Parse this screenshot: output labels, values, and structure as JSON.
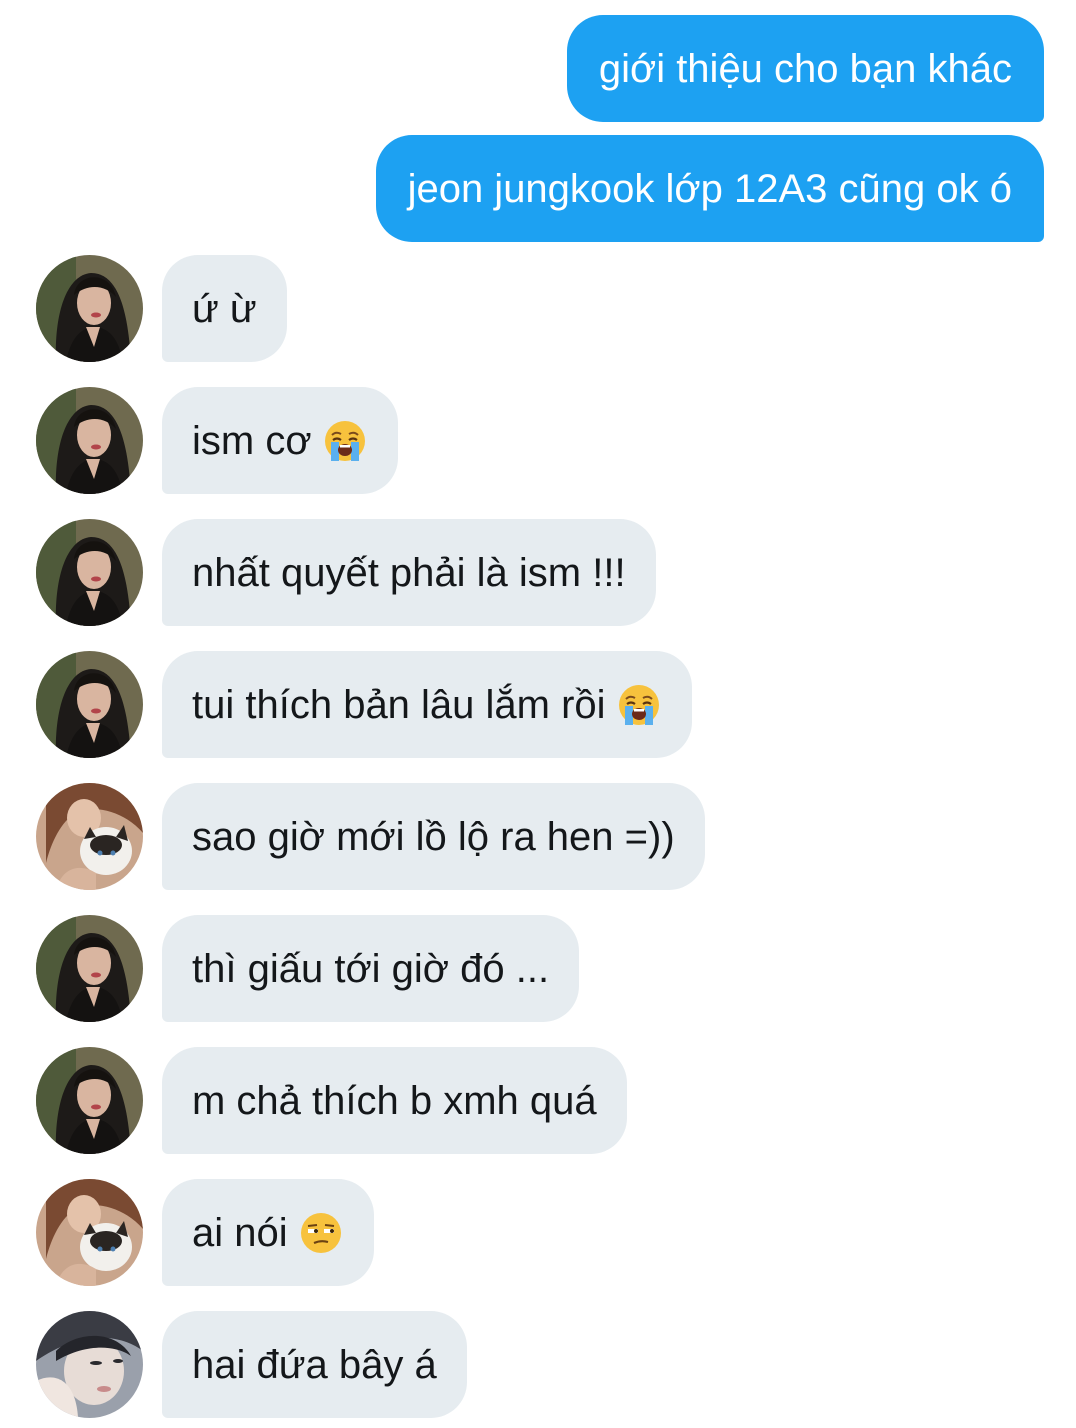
{
  "messages": [
    {
      "direction": "outgoing",
      "text": "giới thiệu cho bạn khác"
    },
    {
      "direction": "outgoing",
      "text": "jeon jungkook lớp 12A3 cũng ok ó"
    },
    {
      "direction": "incoming",
      "avatar": "avatar-dark-hair",
      "text": "ứ ừ"
    },
    {
      "direction": "incoming",
      "avatar": "avatar-dark-hair",
      "text": "ism cơ",
      "emoji": "loudly-crying-face-icon"
    },
    {
      "direction": "incoming",
      "avatar": "avatar-dark-hair",
      "text": "nhất quyết phải là ism !!!"
    },
    {
      "direction": "incoming",
      "avatar": "avatar-dark-hair",
      "text": "tui thích bản lâu lắm rồi",
      "emoji": "loudly-crying-face-icon"
    },
    {
      "direction": "incoming",
      "avatar": "avatar-with-cat",
      "text": "sao giờ mới lồ lộ ra hen =))"
    },
    {
      "direction": "incoming",
      "avatar": "avatar-dark-hair",
      "text": "thì giấu tới giờ đó ..."
    },
    {
      "direction": "incoming",
      "avatar": "avatar-dark-hair",
      "text": "m chả thích b xmh quá"
    },
    {
      "direction": "incoming",
      "avatar": "avatar-with-cat",
      "text": "ai nói",
      "emoji": "unamused-face-icon"
    },
    {
      "direction": "incoming",
      "avatar": "avatar-hand-on-face",
      "text": "hai đứa bây á"
    }
  ],
  "colors": {
    "outgoing_bubble": "#1da1f2",
    "incoming_bubble": "#e6ecf0",
    "incoming_text": "#14171a"
  }
}
